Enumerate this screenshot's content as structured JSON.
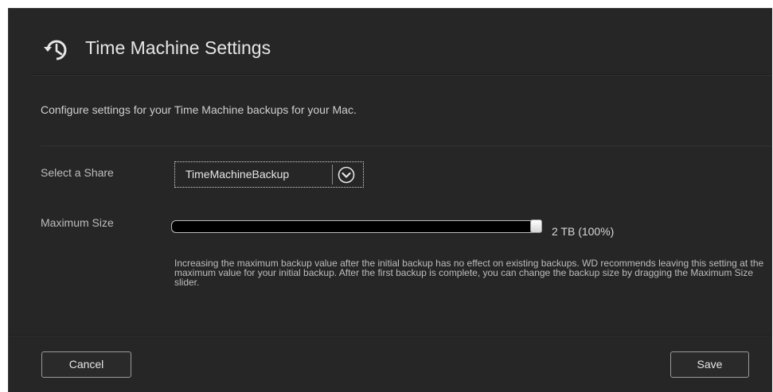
{
  "dialog": {
    "title": "Time Machine Settings",
    "title_icon": "history-clock-icon",
    "description": "Configure settings for your Time Machine backups for your Mac."
  },
  "share": {
    "label": "Select a Share",
    "selected": "TimeMachineBackup",
    "dropdown_icon": "chevron-down-circle-icon"
  },
  "max_size": {
    "label": "Maximum Size",
    "slider_value_percent": 100,
    "value_text": "2 TB (100%)",
    "note": "Increasing the maximum backup value after the initial backup has no effect on existing backups. WD recommends leaving this setting at the maximum value for your initial backup. After the first backup is complete, you can change the backup size by dragging the Maximum Size slider."
  },
  "buttons": {
    "cancel": "Cancel",
    "save": "Save"
  },
  "colors": {
    "background": "#262626",
    "text": "#e6e6e6",
    "muted_text": "#bdbdbd"
  }
}
